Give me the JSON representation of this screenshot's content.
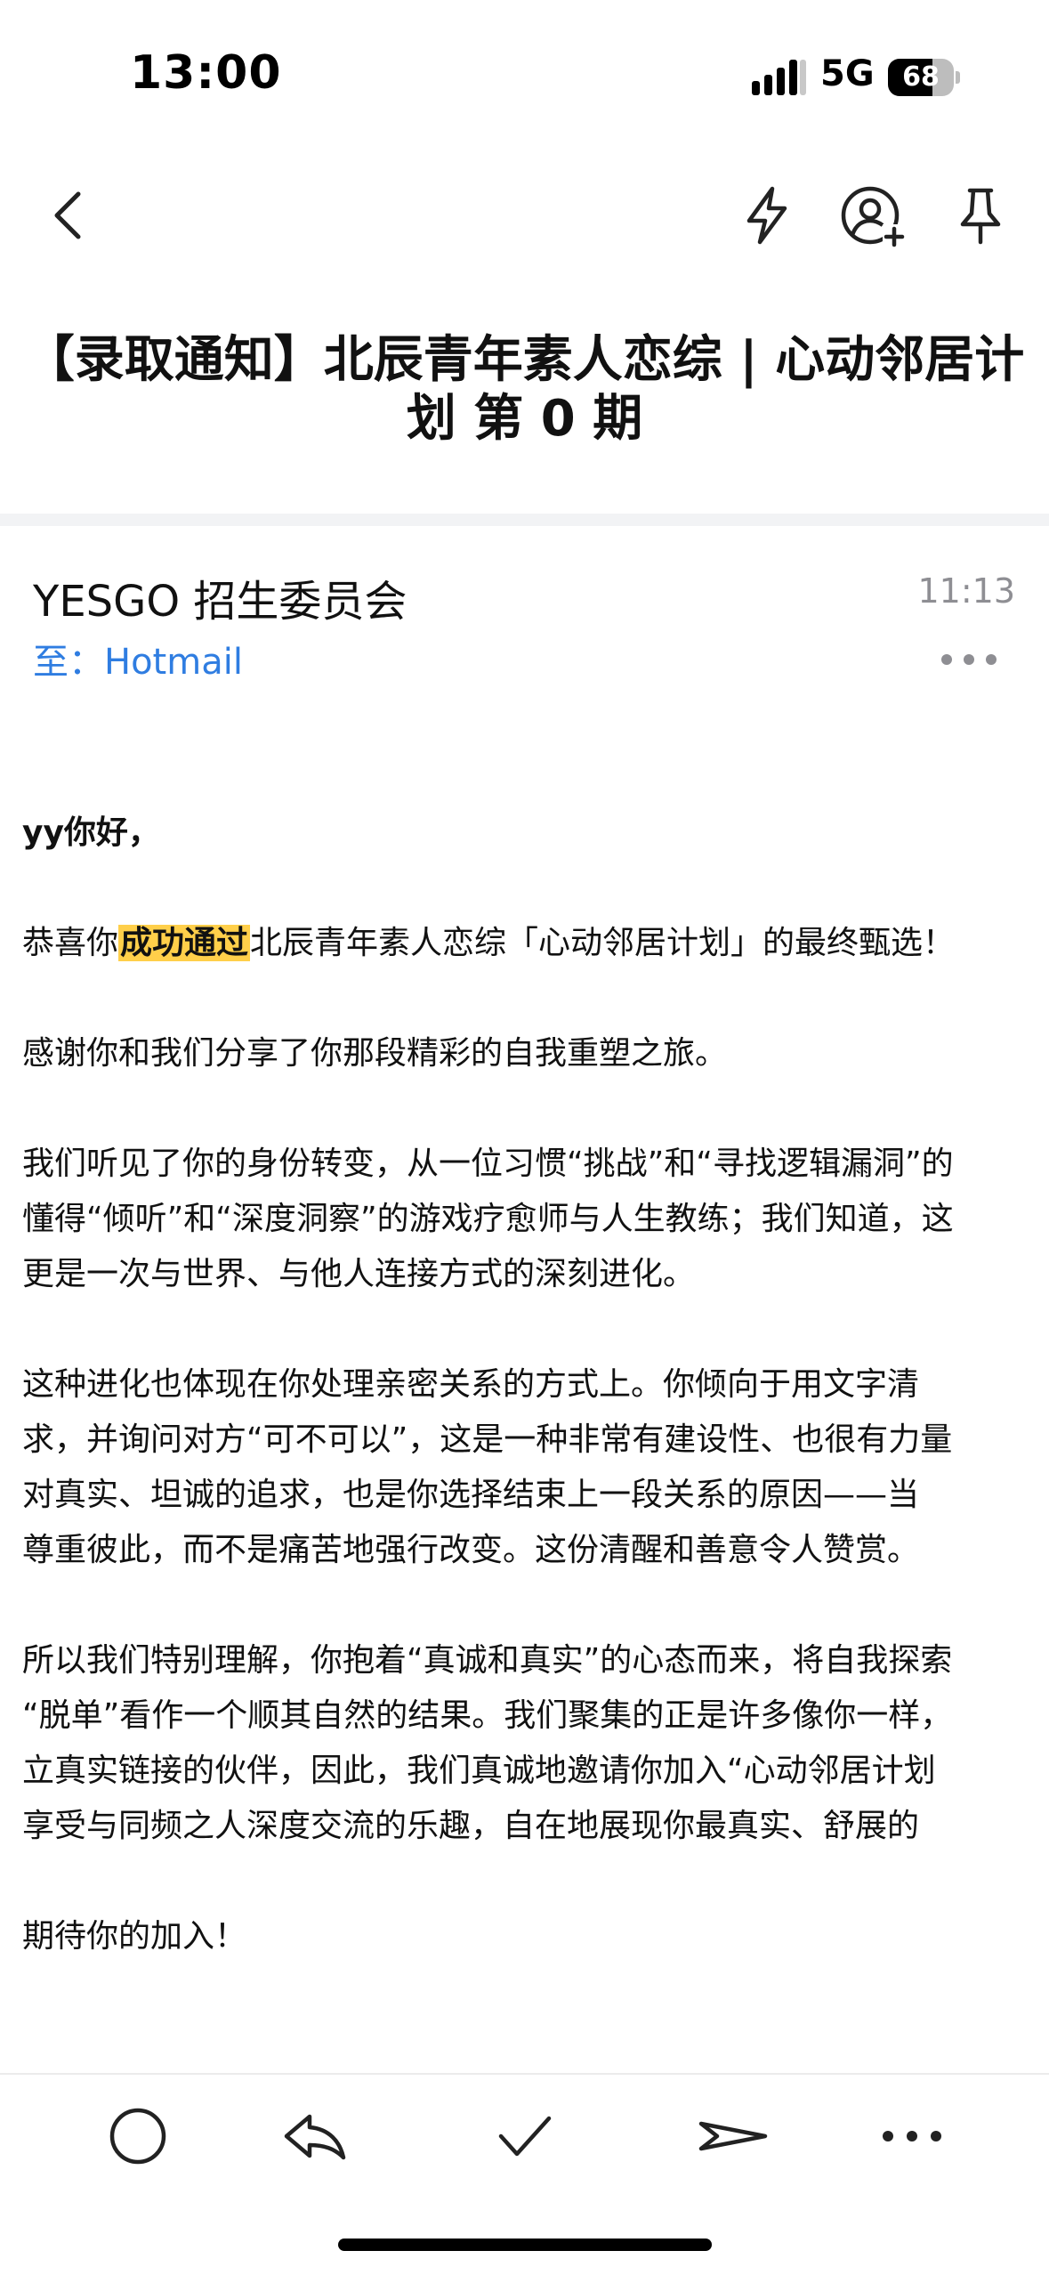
{
  "status_bar": {
    "time": "13:00",
    "network": "5G",
    "battery": "68",
    "battery_level_percent": 68
  },
  "nav": {
    "back_icon": "chevron-left-icon",
    "actions": [
      "lightning-icon",
      "add-contact-icon",
      "pin-icon"
    ]
  },
  "email": {
    "subject": "【录取通知】北辰青年素人恋综 | 心动邻居计划 第 0 期",
    "sender": "YESGO 招生委员会",
    "time": "11:13",
    "recipient_label": "至：",
    "recipient": "Hotmail",
    "body": {
      "greeting": "yy你好，",
      "p1_before": "恭喜你",
      "p1_highlight": "成功通过",
      "p1_after": "北辰青年素人恋综「心动邻居计划」的最终甄选！",
      "p2": "感谢你和我们分享了你那段精彩的自我重塑之旅。",
      "p3_l1": "我们听见了你的身份转变，从一位习惯“挑战”和“寻找逻辑漏洞”的",
      "p3_l2": "懂得“倾听”和“深度洞察”的游戏疗愈师与人生教练；我们知道，这",
      "p3_l3": "更是一次与世界、与他人连接方式的深刻进化。",
      "p4_l1": "这种进化也体现在你处理亲密关系的方式上。你倾向于用文字清",
      "p4_l2": "求，并询问对方“可不可以”，这是一种非常有建设性、也很有力量",
      "p4_l3": "对真实、坦诚的追求，也是你选择结束上一段关系的原因——当",
      "p4_l4": "尊重彼此，而不是痛苦地强行改变。这份清醒和善意令人赞赏。",
      "p5_l1": "所以我们特别理解，你抱着“真诚和真实”的心态而来，将自我探索",
      "p5_l2": "“脱单”看作一个顺其自然的结果。我们聚集的正是许多像你一样，",
      "p5_l3": "立真实链接的伙伴，因此，我们真诚地邀请你加入“心动邻居计划",
      "p5_l4": "享受与同频之人深度交流的乐趣，自在地展现你最真实、舒展的",
      "p6": "期待你的加入！"
    }
  },
  "toolbar": {
    "items": [
      "circle-icon",
      "reply-icon",
      "checkmark-icon",
      "forward-icon",
      "more-horizontal-icon"
    ]
  },
  "colors": {
    "link_blue": "#2f7de1",
    "highlight": "#ffcf4a",
    "muted_gray": "#8e8e93"
  }
}
